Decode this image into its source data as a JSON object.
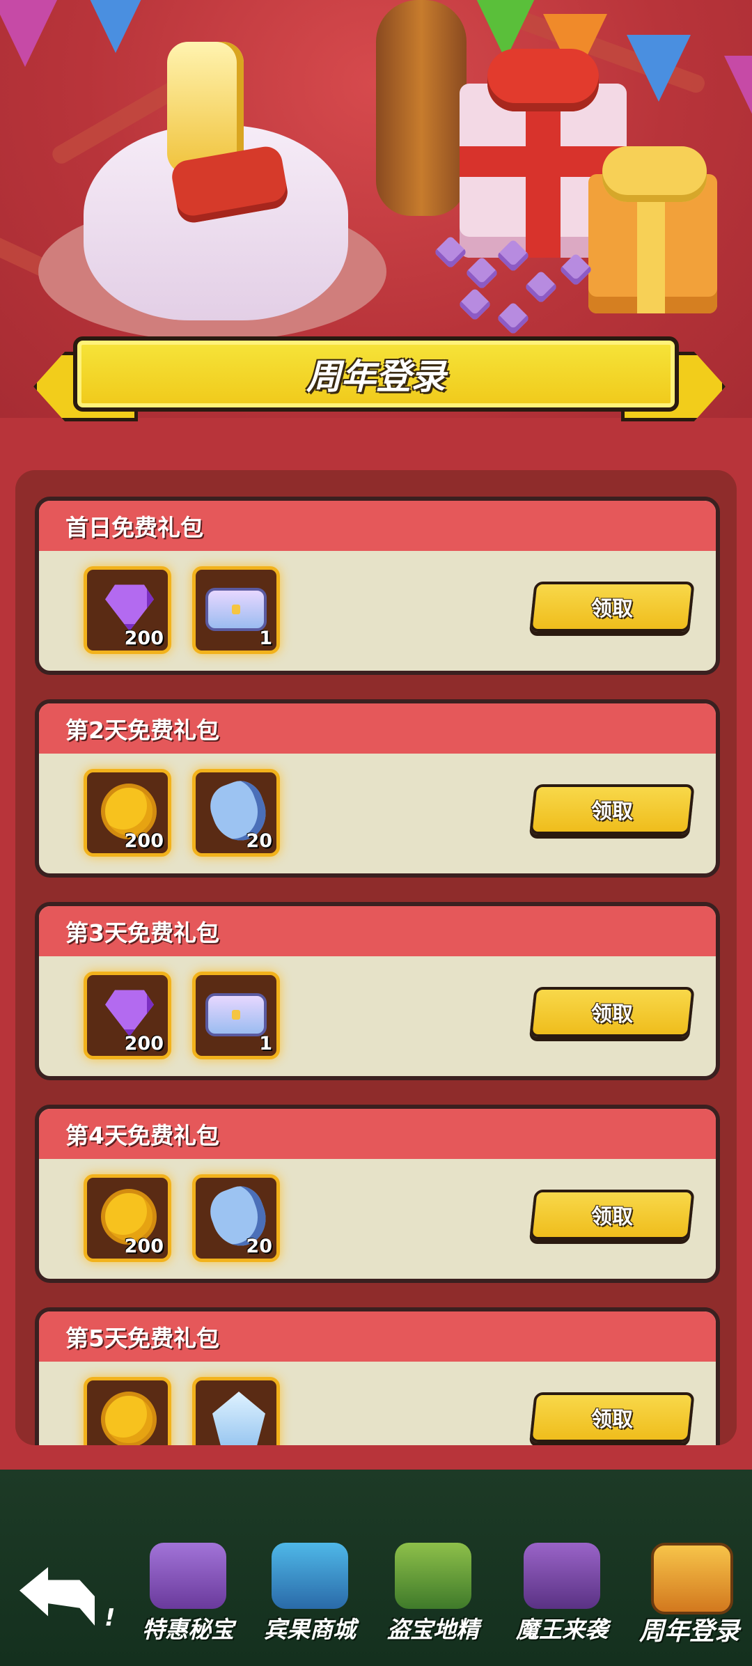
{
  "banner": {
    "title": "周年登录"
  },
  "cards": [
    {
      "title": "首日免费礼包",
      "items": [
        {
          "icon": "purple-gem",
          "count": "200"
        },
        {
          "icon": "treasure-chest",
          "count": "1"
        }
      ],
      "claim_label": "领取"
    },
    {
      "title": "第2天免费礼包",
      "items": [
        {
          "icon": "gold-coin",
          "count": "200"
        },
        {
          "icon": "blue-flower",
          "count": "20"
        }
      ],
      "claim_label": "领取"
    },
    {
      "title": "第3天免费礼包",
      "items": [
        {
          "icon": "purple-gem",
          "count": "200"
        },
        {
          "icon": "treasure-chest",
          "count": "1"
        }
      ],
      "claim_label": "领取"
    },
    {
      "title": "第4天免费礼包",
      "items": [
        {
          "icon": "gold-coin",
          "count": "200"
        },
        {
          "icon": "blue-flower",
          "count": "20"
        }
      ],
      "claim_label": "领取"
    },
    {
      "title": "第5天免费礼包",
      "items": [
        {
          "icon": "gold-coin",
          "count": ""
        },
        {
          "icon": "ice-crystal",
          "count": ""
        }
      ],
      "claim_label": "领取"
    }
  ],
  "nav": {
    "back_icon": "back-arrow-icon",
    "fragment": "!",
    "items": [
      {
        "label": "特惠秘宝",
        "icon": "special-treasure-icon"
      },
      {
        "label": "宾果商城",
        "icon": "bingo-shop-icon"
      },
      {
        "label": "盗宝地精",
        "icon": "treasure-goblin-icon"
      },
      {
        "label": "魔王来袭",
        "icon": "demon-king-icon"
      },
      {
        "label": "周年登录",
        "icon": "anniversary-chest-icon",
        "active": true
      }
    ]
  },
  "colors": {
    "accent": "#f2cd1b",
    "card_header": "#e5585a",
    "panel": "#8f2c2b",
    "nav_bg": "#1d3a26"
  }
}
